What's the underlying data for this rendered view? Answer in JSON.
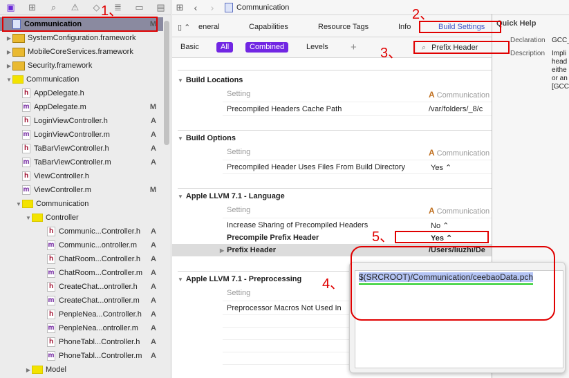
{
  "navigator": {
    "icons": [
      "folder-icon",
      "hierarchy-icon",
      "search-icon",
      "warning-icon",
      "test-icon",
      "list-icon",
      "breakpoint-icon",
      "log-icon"
    ],
    "items": [
      {
        "label": "Communication",
        "badge": "M",
        "type": "project",
        "level": 0
      },
      {
        "label": "SystemConfiguration.framework",
        "badge": "",
        "type": "framework",
        "level": 0,
        "disclosure": "closed"
      },
      {
        "label": "MobileCoreServices.framework",
        "badge": "",
        "type": "framework",
        "level": 0,
        "disclosure": "closed"
      },
      {
        "label": "Security.framework",
        "badge": "",
        "type": "framework",
        "level": 0,
        "disclosure": "closed"
      },
      {
        "label": "Communication",
        "badge": "",
        "type": "folder",
        "level": 0,
        "disclosure": "open"
      },
      {
        "label": "AppDelegate.h",
        "badge": "",
        "type": "h",
        "level": 1
      },
      {
        "label": "AppDelegate.m",
        "badge": "M",
        "type": "m",
        "level": 1
      },
      {
        "label": "LoginViewController.h",
        "badge": "A",
        "type": "h",
        "level": 1
      },
      {
        "label": "LoginViewController.m",
        "badge": "A",
        "type": "m",
        "level": 1
      },
      {
        "label": "TaBarViewController.h",
        "badge": "A",
        "type": "h",
        "level": 1
      },
      {
        "label": "TaBarViewController.m",
        "badge": "A",
        "type": "m",
        "level": 1
      },
      {
        "label": "ViewController.h",
        "badge": "",
        "type": "h",
        "level": 1
      },
      {
        "label": "ViewController.m",
        "badge": "M",
        "type": "m",
        "level": 1
      },
      {
        "label": "Communication",
        "badge": "",
        "type": "folder",
        "level": 1,
        "disclosure": "open"
      },
      {
        "label": "Controller",
        "badge": "",
        "type": "folder",
        "level": 2,
        "disclosure": "open"
      },
      {
        "label": "Communic...Controller.h",
        "badge": "A",
        "type": "h",
        "level": 3
      },
      {
        "label": "Communic...ontroller.m",
        "badge": "A",
        "type": "m",
        "level": 3
      },
      {
        "label": "ChatRoom...Controller.h",
        "badge": "A",
        "type": "h",
        "level": 3
      },
      {
        "label": "ChatRoom...Controller.m",
        "badge": "A",
        "type": "m",
        "level": 3
      },
      {
        "label": "CreateChat...ontroller.h",
        "badge": "A",
        "type": "h",
        "level": 3
      },
      {
        "label": "CreateChat...ontroller.m",
        "badge": "A",
        "type": "m",
        "level": 3
      },
      {
        "label": "PenpleNea...Controller.h",
        "badge": "A",
        "type": "h",
        "level": 3
      },
      {
        "label": "PenpleNea...ontroller.m",
        "badge": "A",
        "type": "m",
        "level": 3
      },
      {
        "label": "PhoneTabl...Controller.h",
        "badge": "A",
        "type": "h",
        "level": 3
      },
      {
        "label": "PhoneTabl...Controller.m",
        "badge": "A",
        "type": "m",
        "level": 3
      },
      {
        "label": "Model",
        "badge": "",
        "type": "folder",
        "level": 2,
        "disclosure": "closed"
      }
    ]
  },
  "toolbar": {
    "breadcrumb": "Communication"
  },
  "tabs": [
    "eneral",
    "Capabilities",
    "Resource Tags",
    "Info",
    "Build Settings"
  ],
  "filters": {
    "basic": "Basic",
    "all": "All",
    "combined": "Combined",
    "levels": "Levels",
    "add": "+",
    "search_value": "Prefix Header"
  },
  "sections": [
    {
      "title": "Build Locations",
      "setting_label": "Setting",
      "target": "Communication",
      "rows": [
        {
          "name": "Precompiled Headers Cache Path",
          "value": "/var/folders/_8/c"
        }
      ]
    },
    {
      "title": "Build Options",
      "setting_label": "Setting",
      "target": "Communication",
      "rows": [
        {
          "name": "Precompiled Header Uses Files From Build Directory",
          "value": "Yes ⌃"
        }
      ]
    },
    {
      "title": "Apple LLVM 7.1 - Language",
      "setting_label": "Setting",
      "target": "Communication",
      "rows": [
        {
          "name": "Increase Sharing of Precompiled Headers",
          "value": "No ⌃"
        },
        {
          "name": "Precompile Prefix Header",
          "value": "Yes ⌃"
        },
        {
          "name": "Prefix Header",
          "value": "/Users/liuzhi/De"
        }
      ]
    },
    {
      "title": "Apple LLVM 7.1 - Preprocessing",
      "setting_label": "Setting",
      "target": "",
      "rows": [
        {
          "name": "Preprocessor Macros Not Used In",
          "value": ""
        }
      ]
    }
  ],
  "popover": {
    "value": "$(SRCROOT)/Communication/ceebaoData.pch"
  },
  "quick_help": {
    "title": "Quick Help",
    "declaration_label": "Declaration",
    "declaration": "GCC_",
    "description_label": "Description",
    "description": [
      "Impli",
      "head",
      "eithe",
      "or an",
      "[GCC"
    ]
  },
  "annotations": [
    "1、",
    "2、",
    "3、",
    "4、",
    "5、"
  ],
  "colors": {
    "accent": "#7126e3",
    "annotation": "#e00000",
    "underline": "#22cc22",
    "selection": "#b4c4f4"
  }
}
